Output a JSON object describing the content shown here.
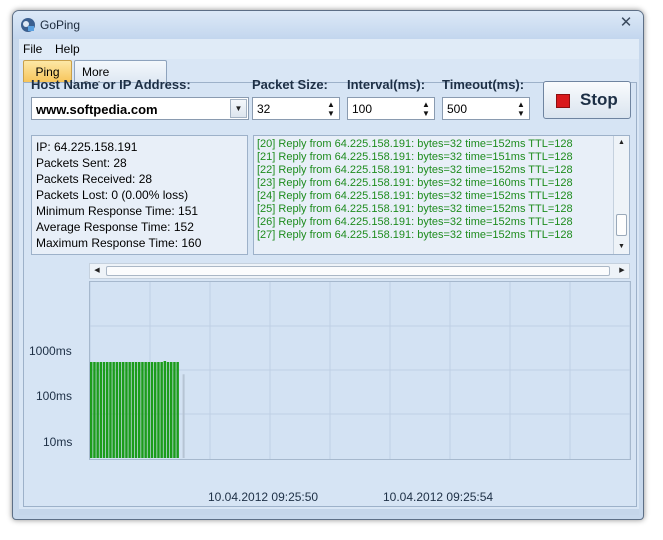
{
  "window": {
    "title": "GoPing",
    "close_label": "✕"
  },
  "menu": {
    "items": [
      "File",
      "Help"
    ]
  },
  "tabs": {
    "ping": "Ping",
    "more": "More Software"
  },
  "form": {
    "host_label": "Host Name or IP Address:",
    "host_value": "www.softpedia.com",
    "packet_size_label": "Packet Size:",
    "packet_size_value": "32",
    "interval_label": "Interval(ms):",
    "interval_value": "100",
    "timeout_label": "Timeout(ms):",
    "timeout_value": "500",
    "stop_label": "Stop",
    "stop_color": "#d9191c"
  },
  "stats": {
    "lines": [
      "IP: 64.225.158.191",
      "Packets Sent: 28",
      "Packets Received: 28",
      "Packets Lost: 0 (0.00% loss)",
      "Minimum Response Time: 151",
      "Average Response Time: 152",
      "Maximum Response Time: 160"
    ]
  },
  "log": {
    "color": "#1e8c1e",
    "lines": [
      "[20] Reply from 64.225.158.191: bytes=32 time=152ms TTL=128",
      "[21] Reply from 64.225.158.191: bytes=32 time=151ms TTL=128",
      "[22] Reply from 64.225.158.191: bytes=32 time=152ms TTL=128",
      "[23] Reply from 64.225.158.191: bytes=32 time=160ms TTL=128",
      "[24] Reply from 64.225.158.191: bytes=32 time=152ms TTL=128",
      "[25] Reply from 64.225.158.191: bytes=32 time=152ms TTL=128",
      "[26] Reply from 64.225.158.191: bytes=32 time=152ms TTL=128",
      "[27] Reply from 64.225.158.191: bytes=32 time=152ms TTL=128"
    ]
  },
  "chart_data": {
    "type": "bar",
    "y_scale": "log",
    "ylim": [
      1,
      10000
    ],
    "y_ticks": [
      "1000ms",
      "100ms",
      "10ms"
    ],
    "y_tick_values": [
      1000,
      100,
      10
    ],
    "x_tick_labels": [
      "10.04.2012 09:25:50",
      "10.04.2012 09:25:54"
    ],
    "grid": true,
    "bar_color": "#1b9c1b",
    "values": [
      152,
      152,
      151,
      152,
      152,
      152,
      152,
      152,
      152,
      152,
      152,
      152,
      152,
      152,
      152,
      152,
      152,
      152,
      152,
      152,
      151,
      152,
      152,
      160,
      152,
      152,
      152,
      152
    ],
    "trailing_marker": 80
  }
}
